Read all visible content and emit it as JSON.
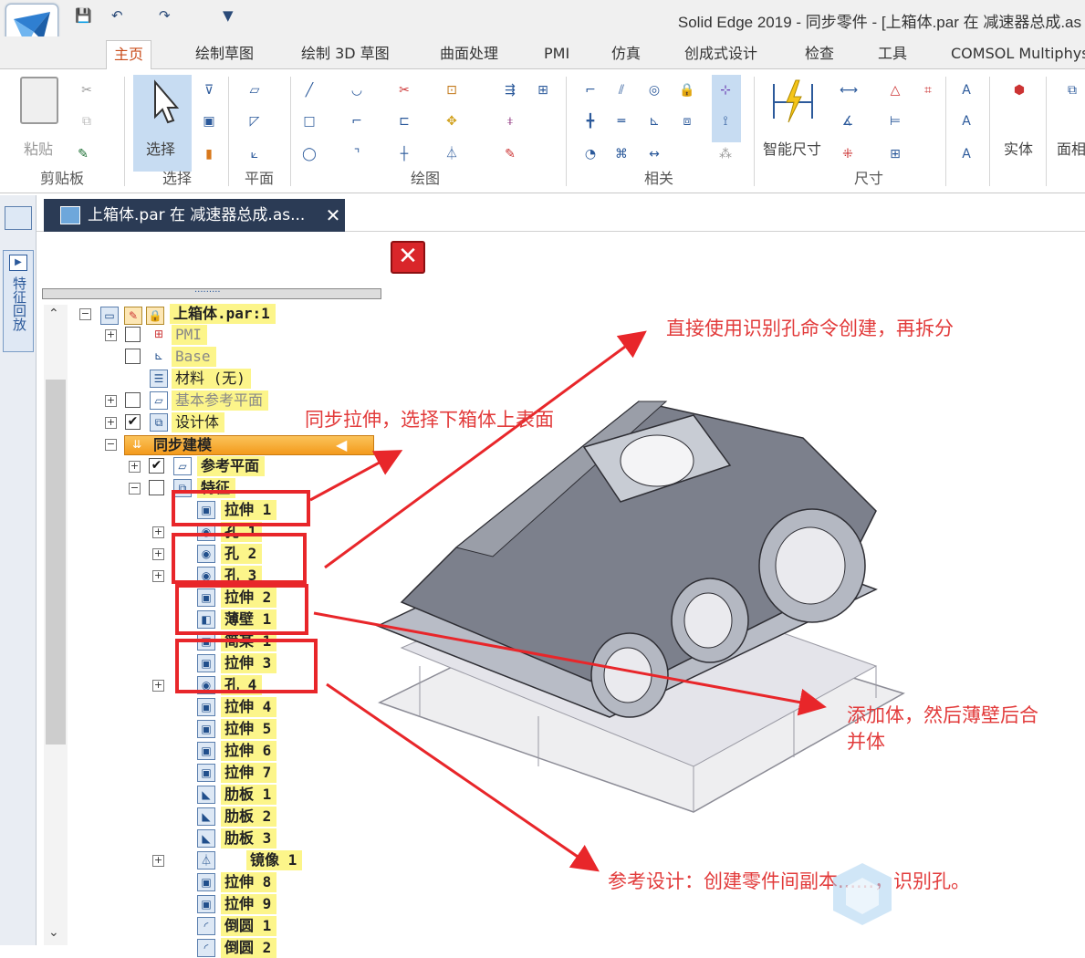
{
  "window": {
    "title": "Solid Edge 2019 - 同步零件 - [上箱体.par 在 减速器总成.as"
  },
  "tabs": [
    "主页",
    "绘制草图",
    "绘制 3D 草图",
    "曲面处理",
    "PMI",
    "仿真",
    "创成式设计",
    "检查",
    "工具",
    "COMSOL Multiphysi"
  ],
  "ribbon": {
    "groups": [
      "剪贴板",
      "选择",
      "平面",
      "绘图",
      "相关",
      "尺寸"
    ],
    "paste_label": "粘贴",
    "select_label": "选择",
    "smart_dim_label": "智能尺寸",
    "solid_label": "实体",
    "face_label": "面相"
  },
  "left_strip": {
    "label": "特征回放"
  },
  "doc_tab": {
    "title": "上箱体.par 在 减速器总成.as...",
    "close": "✕"
  },
  "tree": {
    "root": "上箱体.par:1",
    "items": [
      {
        "label": "PMI"
      },
      {
        "label": "Base"
      },
      {
        "label": "材料 (无)"
      },
      {
        "label": "基本参考平面"
      },
      {
        "label": "设计体"
      },
      {
        "label": "同步建模"
      },
      {
        "label": "参考平面"
      },
      {
        "label": "特征"
      },
      {
        "label": "拉伸 1"
      },
      {
        "label": "孔 1"
      },
      {
        "label": "孔 2"
      },
      {
        "label": "孔 3"
      },
      {
        "label": "拉伸 2"
      },
      {
        "label": "薄壁 1"
      },
      {
        "label": "简某 1"
      },
      {
        "label": "拉伸 3"
      },
      {
        "label": "孔 4"
      },
      {
        "label": "拉伸 4"
      },
      {
        "label": "拉伸 5"
      },
      {
        "label": "拉伸 6"
      },
      {
        "label": "拉伸 7"
      },
      {
        "label": "肋板 1"
      },
      {
        "label": "肋板 2"
      },
      {
        "label": "肋板 3"
      },
      {
        "label": "镜像 1"
      },
      {
        "label": "拉伸 8"
      },
      {
        "label": "拉伸 9"
      },
      {
        "label": "倒圆 1"
      },
      {
        "label": "倒圆 2"
      }
    ]
  },
  "annotations": {
    "a1": "直接使用识别孔命令创建，再拆分",
    "a2": "同步拉伸，选择下箱体上表面",
    "a3_line1": "添加体，然后薄壁后合",
    "a3_line2": "并体",
    "a4": "参考设计：创建零件间副本......，识别孔。"
  },
  "colors": {
    "accent": "#c94d1b",
    "annotation": "#e23b3b",
    "highlight": "#fcf58a",
    "doc_tab": "#2b3b55"
  }
}
